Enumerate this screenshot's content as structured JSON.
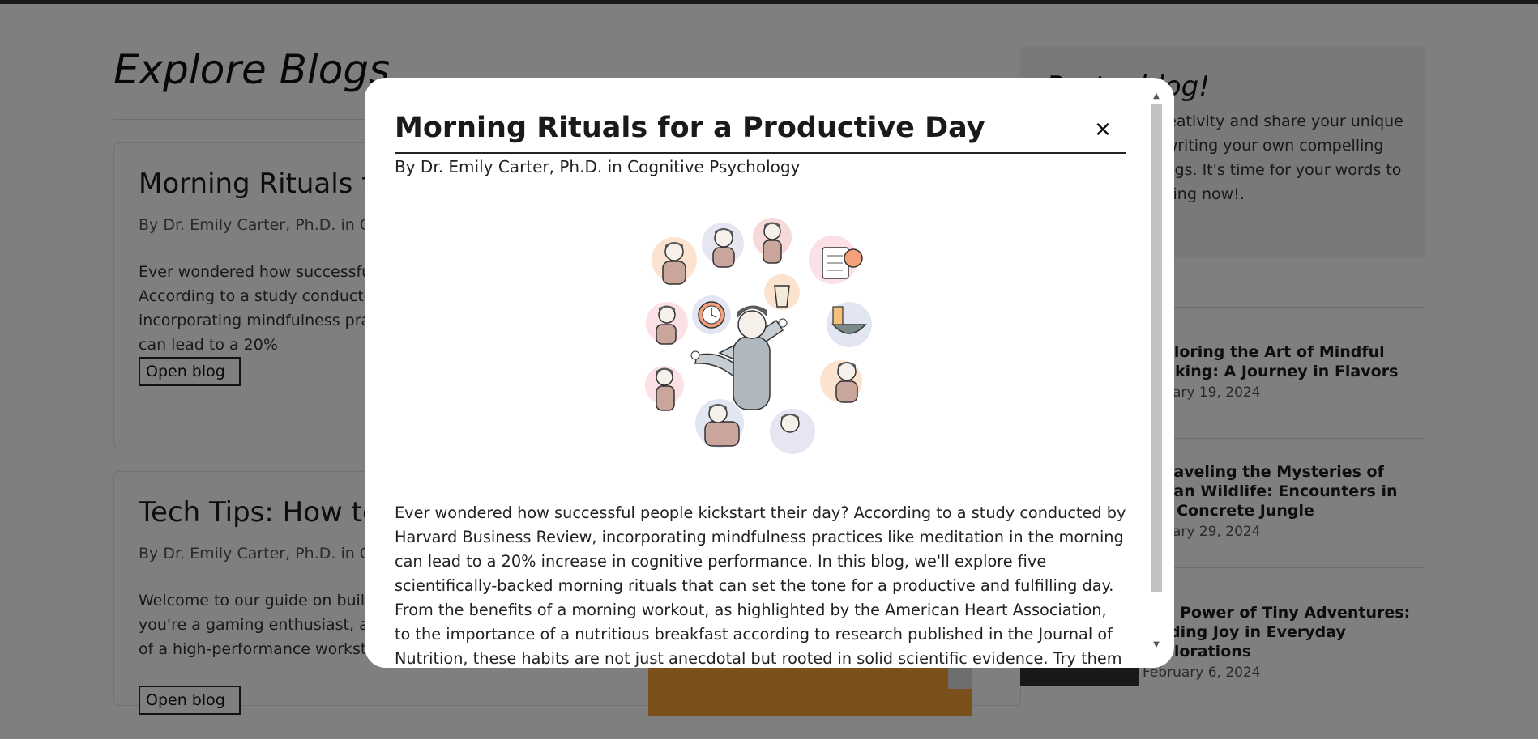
{
  "page": {
    "title": "Explore Blogs"
  },
  "cards": [
    {
      "title": "Morning Rituals for a Productive Day",
      "author": "By Dr. Emily Carter, Ph.D. in Cognitive Psychology",
      "excerpt": "Ever wondered how successful people kickstart their day? According to a study conducted by Harvard Business Review, incorporating mindfulness practices like meditation in the morning can lead to a 20%",
      "button": "Open blog"
    },
    {
      "title": "Tech Tips: How to Build Your Own Gaming PC",
      "author": "By Dr. Emily Carter, Ph.D. in Cognitive Psychology",
      "excerpt": "Welcome to our guide on building your own gaming PC! Whether you're a gaming enthusiast, a content creator, or someone in need of a high-performance workstation,",
      "button": "Open blog"
    }
  ],
  "sidebar": {
    "box_title": "Post a blog!",
    "box_text": "Unleash your creativity and share your unique perspective by writing your own compelling and inspiring blogs. It's time for your words to shine. Start posting now!.",
    "items": [
      {
        "title": "Exploring the Art of Mindful Cooking: A Journey in Flavors",
        "date": "January 19, 2024"
      },
      {
        "title": "Unraveling the Mysteries of Urban Wildlife: Encounters in the Concrete Jungle",
        "date": "January 29, 2024"
      },
      {
        "title": "The Power of Tiny Adventures: Finding Joy in Everyday Explorations",
        "date": "February 6, 2024"
      }
    ]
  },
  "modal": {
    "title": "Morning Rituals for a Productive Day",
    "close_glyph": "✕",
    "author": "By Dr. Emily Carter, Ph.D. in Cognitive Psychology",
    "image_icon": "morning-routine-illustration",
    "body": "Ever wondered how successful people kickstart their day? According to a study conducted by Harvard Business Review, incorporating mindfulness practices like meditation in the morning can lead to a 20% increase in cognitive performance. In this blog, we'll explore five scientifically-backed morning rituals that can set the tone for a productive and fulfilling day. From the benefits of a morning workout, as highlighted by the American Heart Association, to the importance of a nutritious breakfast according to research published in the Journal of Nutrition, these habits are not just anecdotal but rooted in solid scientific evidence. Try them out and watch as your mornings transform into a time of focus and"
  },
  "colors": {
    "overlay": "rgba(0,0,0,0.5)",
    "modal_bg": "#ffffff",
    "text": "#222222"
  }
}
